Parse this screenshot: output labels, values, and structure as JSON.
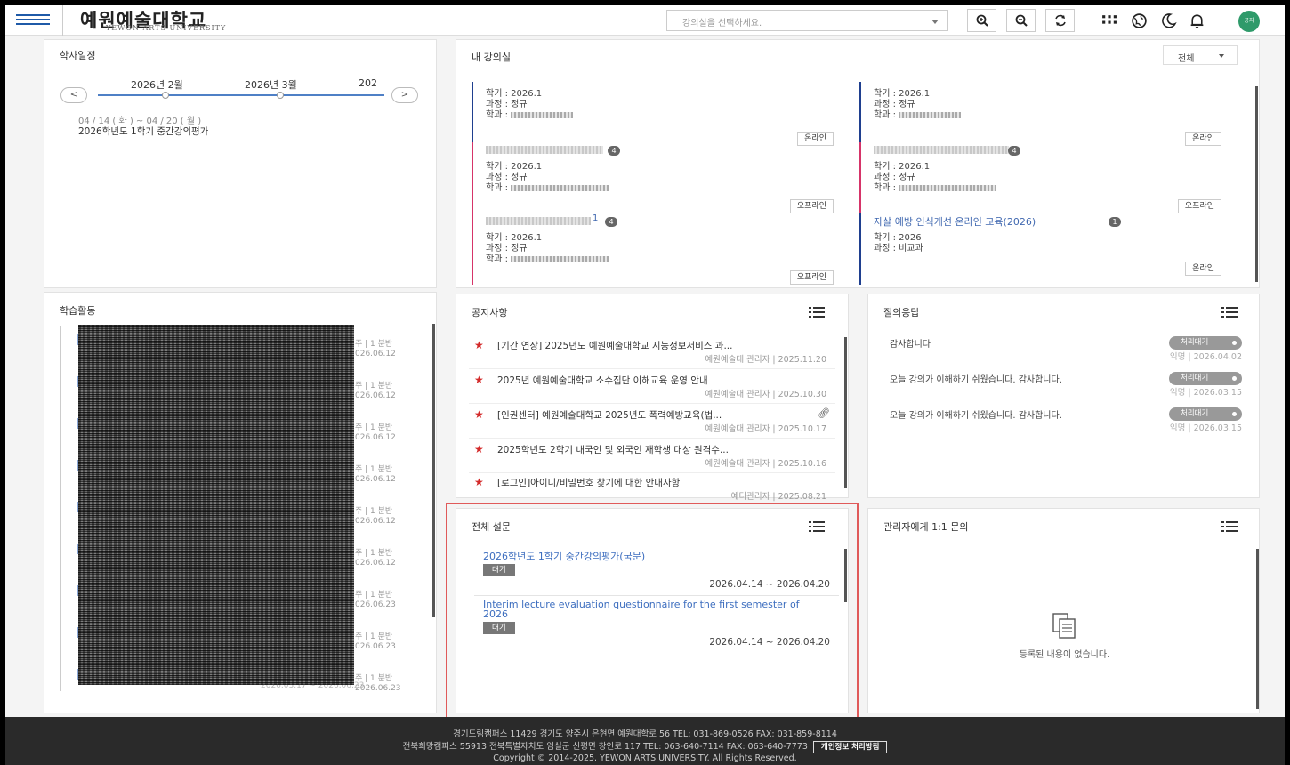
{
  "header": {
    "logo_ko": "예원예술대학교",
    "logo_en": "YEWON ARTS UNIVERSITY",
    "classroom_select_placeholder": "강의실을 선택하세요.",
    "avatar_text": "공지"
  },
  "calendar": {
    "title": "학사일정",
    "months": [
      "2026년 2월",
      "2026년 3월",
      "202"
    ],
    "prev_label": "<",
    "next_label": ">",
    "event_date": "04 / 14 ( 화 ) ~ 04 / 20 ( 월 )",
    "event_title": "2026학년도 1학기 중간강의평가"
  },
  "my_classroom": {
    "title": "내 강의실",
    "filter": "전체",
    "courses": [
      {
        "semester": "학기 : 2026.1",
        "course": "과정 : 정규",
        "dept": "학과 :",
        "badge": "",
        "mode": "온라인",
        "title": ""
      },
      {
        "semester": "학기 : 2026.1",
        "course": "과정 : 정규",
        "dept": "학과 :",
        "badge": "",
        "mode": "온라인",
        "title": ""
      },
      {
        "semester": "학기 : 2026.1",
        "course": "과정 : 정규",
        "dept": "학과 :",
        "badge": "4",
        "mode": "오프라인",
        "title": ""
      },
      {
        "semester": "학기 : 2026.1",
        "course": "과정 : 정규",
        "dept": "학과 :",
        "badge": "4",
        "mode": "오프라인",
        "title": ""
      },
      {
        "semester": "학기 : 2026.1",
        "course": "과정 : 정규",
        "dept": "학과 :",
        "badge": "4",
        "mode": "오프라인",
        "title": "1"
      },
      {
        "semester": "학기 : 2026",
        "course": "과정 : 비교과",
        "dept": "",
        "badge": "1",
        "mode": "온라인",
        "title": "자살 예방 인식개선 온라인 교육(2026)"
      }
    ]
  },
  "activity": {
    "title": "학습활동",
    "items": [
      {
        "meta1": "주 | 1 분반",
        "meta2": "026.06.12"
      },
      {
        "meta1": "주 | 1 분반",
        "meta2": "026.06.12"
      },
      {
        "meta1": "주 | 1 분반",
        "meta2": "026.06.12"
      },
      {
        "meta1": "주 | 1 분반",
        "meta2": "026.06.12"
      },
      {
        "meta1": "주 | 1 분반",
        "meta2": "026.06.12"
      },
      {
        "meta1": "주 | 1 분반",
        "meta2": "026.06.12"
      },
      {
        "meta1": "주 | 1 분반",
        "meta2": "026.06.23"
      },
      {
        "meta1": "주 | 1 분반",
        "meta2": "026.06.23"
      },
      {
        "meta1": "주 | 1 분반",
        "meta2": "2026.06.23"
      }
    ],
    "last_date": "2026.03.17 ~ 2026.06.23"
  },
  "notices": {
    "title": "공지사항",
    "items": [
      {
        "title": "[기간 연장] 2025년도 예원예술대학교 지능정보서비스 과...",
        "author": "예원예술대 관리자",
        "date": "2025.11.20"
      },
      {
        "title": "2025년 예원예술대학교 소수집단 이해교육 운영 안내",
        "author": "예원예술대 관리자",
        "date": "2025.10.30"
      },
      {
        "title": "[인권센터] 예원예술대학교 2025년도 폭력예방교육(법...",
        "author": "예원예술대 관리자",
        "date": "2025.10.17"
      },
      {
        "title": "2025학년도 2학기 내국인 및 외국인 재학생 대상 원격수...",
        "author": "예원예술대 관리자",
        "date": "2025.10.16"
      },
      {
        "title": "[로그인]아이디/비밀번호 찾기에 대한 안내사항",
        "author": "예디관리자",
        "date": "2025.08.21"
      }
    ]
  },
  "qna": {
    "title": "질의응답",
    "items": [
      {
        "text": "감사합니다",
        "status": "처리대기",
        "author": "익명",
        "date": "2026.04.02"
      },
      {
        "text": "오늘 강의가 이해하기 쉬웠습니다. 감사합니다.",
        "status": "처리대기",
        "author": "익명",
        "date": "2026.03.15"
      },
      {
        "text": "오늘 강의가 이해하기 쉬웠습니다. 감사합니다.",
        "status": "처리대기",
        "author": "익명",
        "date": "2026.03.15"
      }
    ]
  },
  "survey": {
    "title": "전체 설문",
    "items": [
      {
        "title": "2026학년도 1학기 중간강의평가(국문)",
        "status": "대기",
        "period": "2026.04.14 ~ 2026.04.20"
      },
      {
        "title": "Interim lecture evaluation questionnaire for the first semester of 2026",
        "status": "대기",
        "period": "2026.04.14 ~ 2026.04.20"
      }
    ]
  },
  "admin_inquiry": {
    "title": "관리자에게 1:1 문의",
    "empty_text": "등록된 내용이 없습니다."
  },
  "footer": {
    "line1": "경기드림캠퍼스 11429 경기도 양주시 은현면 예원대학로 56 TEL: 031-869-0526 FAX: 031-859-8114",
    "line2": "전북희망캠퍼스 55913 전북특별자치도 임실군 신평면 창인로 117 TEL: 063-640-7114 FAX: 063-640-7773",
    "privacy": "개인정보 처리방침",
    "copyright": "Copyright © 2014-2025. YEWON ARTS UNIVERSITY. All Rights Reserved."
  },
  "colors": {
    "brand_blue": "#1f5aa8",
    "online_border": "#1f3f8f",
    "offline_border": "#d63469",
    "highlight": "#e05a5a"
  }
}
